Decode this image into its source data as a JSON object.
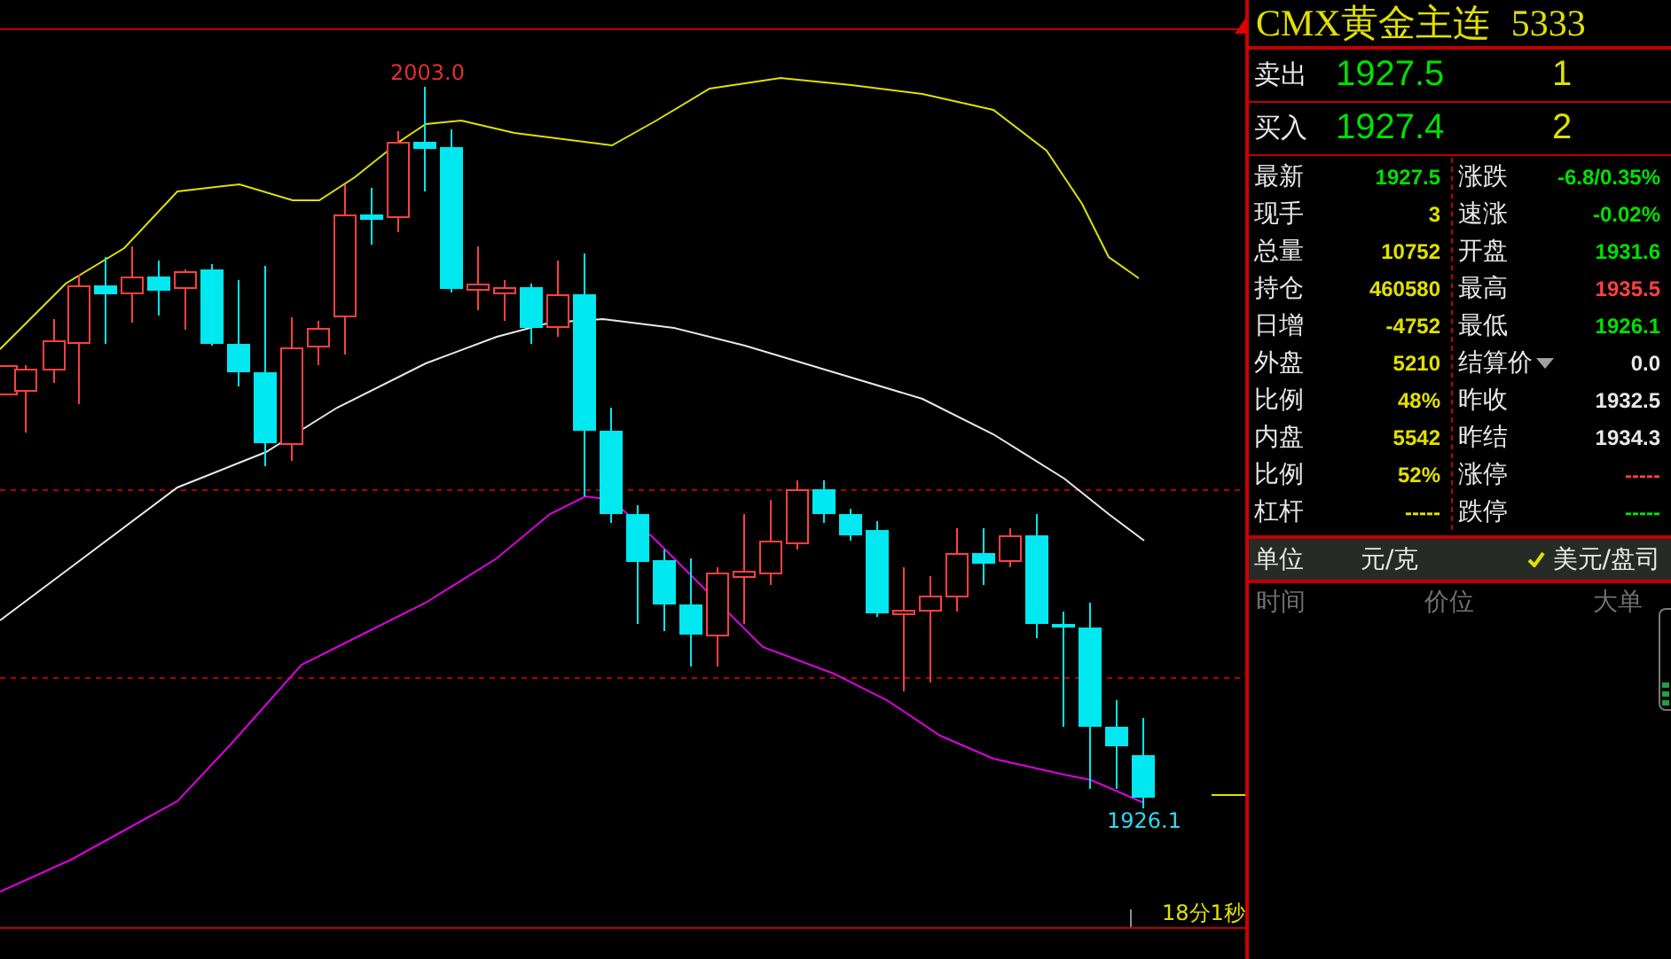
{
  "chart": {
    "high_label": "2003.0",
    "low_label": "1926.1",
    "countdown": "18分1秒"
  },
  "quote": {
    "title": "CMX黄金主连",
    "code": "5333"
  },
  "orders": [
    {
      "label": "卖出",
      "price": "1927.5",
      "count": "1"
    },
    {
      "label": "买入",
      "price": "1927.4",
      "count": "2"
    }
  ],
  "left_stats": [
    {
      "label": "最新",
      "value": "1927.5",
      "color": "#00e000"
    },
    {
      "label": "现手",
      "value": "3",
      "color": "#e0e000"
    },
    {
      "label": "总量",
      "value": "10752",
      "color": "#e0e000"
    },
    {
      "label": "持仓",
      "value": "460580",
      "color": "#e0e000"
    },
    {
      "label": "日增",
      "value": "-4752",
      "color": "#e0e000"
    },
    {
      "label": "外盘",
      "value": "5210",
      "color": "#e0e000"
    },
    {
      "label": "比例",
      "value": "48%",
      "color": "#e0e000"
    },
    {
      "label": "内盘",
      "value": "5542",
      "color": "#e0e000"
    },
    {
      "label": "比例",
      "value": "52%",
      "color": "#e0e000"
    },
    {
      "label": "杠杆",
      "value": "-----",
      "color": "#e0e000"
    }
  ],
  "right_stats": [
    {
      "label": "涨跌",
      "value": "-6.8/0.35%",
      "color": "#00e000",
      "dropdown": false
    },
    {
      "label": "速涨",
      "value": "-0.02%",
      "color": "#00e000",
      "dropdown": false
    },
    {
      "label": "开盘",
      "value": "1931.6",
      "color": "#00e000",
      "dropdown": false
    },
    {
      "label": "最高",
      "value": "1935.5",
      "color": "#ff4040",
      "dropdown": false
    },
    {
      "label": "最低",
      "value": "1926.1",
      "color": "#00e000",
      "dropdown": false
    },
    {
      "label": "结算价",
      "value": "0.0",
      "color": "#e8e8e8",
      "dropdown": true
    },
    {
      "label": "昨收",
      "value": "1932.5",
      "color": "#e8e8e8",
      "dropdown": false
    },
    {
      "label": "昨结",
      "value": "1934.3",
      "color": "#e8e8e8",
      "dropdown": false
    },
    {
      "label": "涨停",
      "value": "-----",
      "color": "#ff4040",
      "dropdown": false
    },
    {
      "label": "跌停",
      "value": "-----",
      "color": "#00e000",
      "dropdown": false
    }
  ],
  "units": {
    "label": "单位",
    "options": [
      {
        "label": "元/克",
        "selected": false
      },
      {
        "label": "美元/盘司",
        "selected": true
      }
    ]
  },
  "ticks_header": [
    "时间",
    "价位",
    "大单"
  ]
}
